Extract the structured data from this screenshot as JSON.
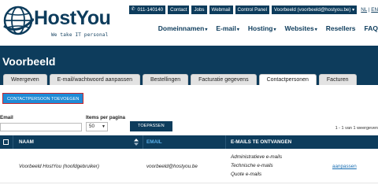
{
  "brand": {
    "name": "HostYou",
    "tagline": "We take IT personal"
  },
  "topbar": {
    "phone": "011-140140",
    "links": [
      "Contact",
      "Jobs",
      "Webmail",
      "Control Panel"
    ],
    "account": "Voorbeeld (voorbeeld@hostyou.be)",
    "lang_nl": "NL",
    "lang_sep": "|",
    "lang_en": "EN"
  },
  "nav": [
    {
      "label": "Domeinnamen",
      "caret": "▾"
    },
    {
      "label": "E-mail",
      "caret": "▾"
    },
    {
      "label": "Hosting",
      "caret": "▾"
    },
    {
      "label": "Websites",
      "caret": "▾"
    },
    {
      "label": "Resellers",
      "caret": ""
    },
    {
      "label": "FAQ",
      "caret": ""
    }
  ],
  "page": {
    "title": "Voorbeeld"
  },
  "tabs": [
    {
      "label": "Weergeven",
      "active": false
    },
    {
      "label": "E-mail/wachtwoord aanpassen",
      "active": false
    },
    {
      "label": "Bestellingen",
      "active": false
    },
    {
      "label": "Facturatie gegevens",
      "active": false
    },
    {
      "label": "Contactpersonen",
      "active": true
    },
    {
      "label": "Facturen",
      "active": false
    }
  ],
  "actions": {
    "add_contact": "CONTACTPERSOON TOEVOEGEN"
  },
  "filter": {
    "email_label": "Email",
    "email_value": "",
    "items_label": "Items per pagina",
    "items_value": "50",
    "apply": "TOEPASSEN",
    "result_count": "1 - 1 van 1 weergeven"
  },
  "table": {
    "headers": {
      "name": "NAAM",
      "email": "EMAIL",
      "emails_receive": "E-MAILS TE ONTVANGEN"
    },
    "rows": [
      {
        "name": "Voorbeeld HostYou (hoofdgebruiker)",
        "email": "voorbeeld@hostyou.be",
        "receives": [
          "Administratieve e-mails",
          "Technische e-mails",
          "Quote e-mails"
        ],
        "action": "aanpassen"
      }
    ]
  },
  "colors": {
    "navy": "#0d3c5c",
    "accent_blue": "#1f8bd6",
    "highlight_red": "#c9252b",
    "link": "#1a6fb3"
  }
}
